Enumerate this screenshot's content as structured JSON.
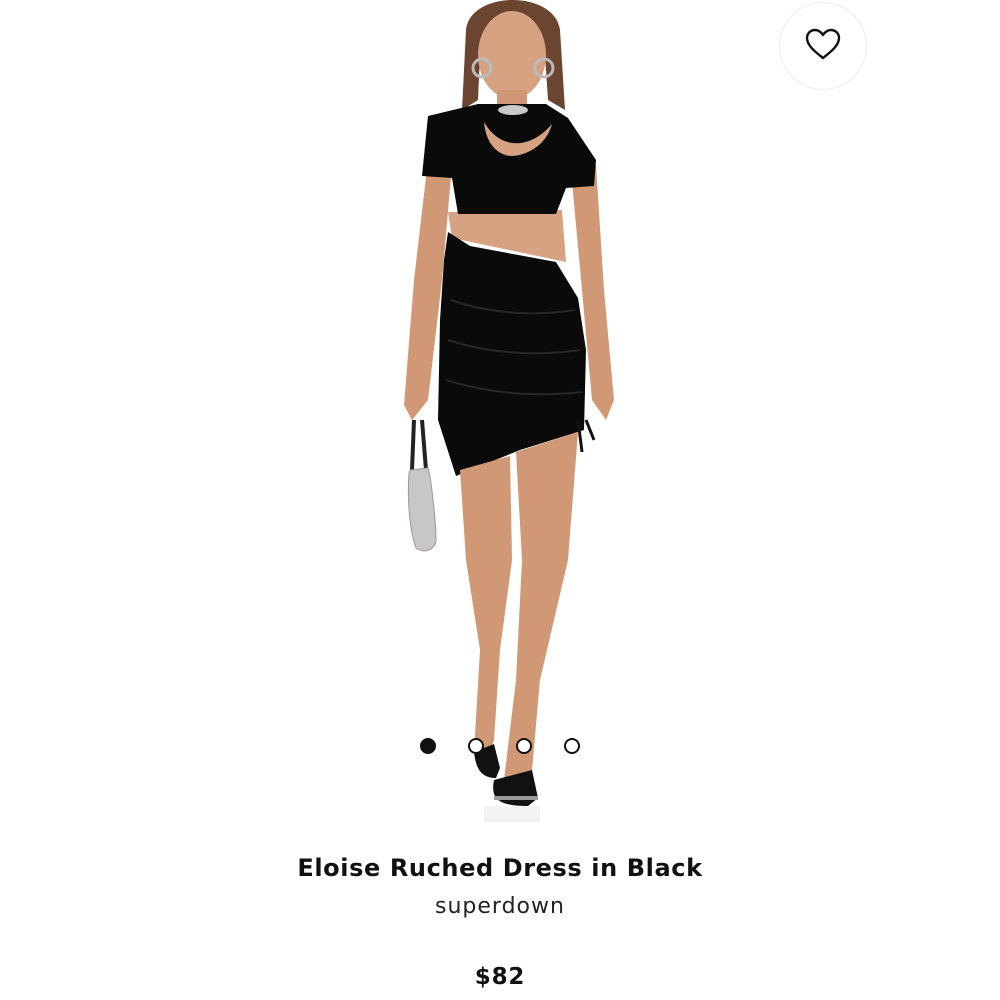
{
  "product": {
    "name": "Eloise Ruched Dress in Black",
    "brand": "superdown",
    "price": "$82"
  },
  "carousel": {
    "total_images": 4,
    "active_index": 0
  },
  "icons": {
    "favorite": "heart-outline-icon"
  },
  "colors": {
    "dress": "#0a0a0a",
    "skin": "#d49a76",
    "background": "#ffffff",
    "text": "#111111"
  }
}
